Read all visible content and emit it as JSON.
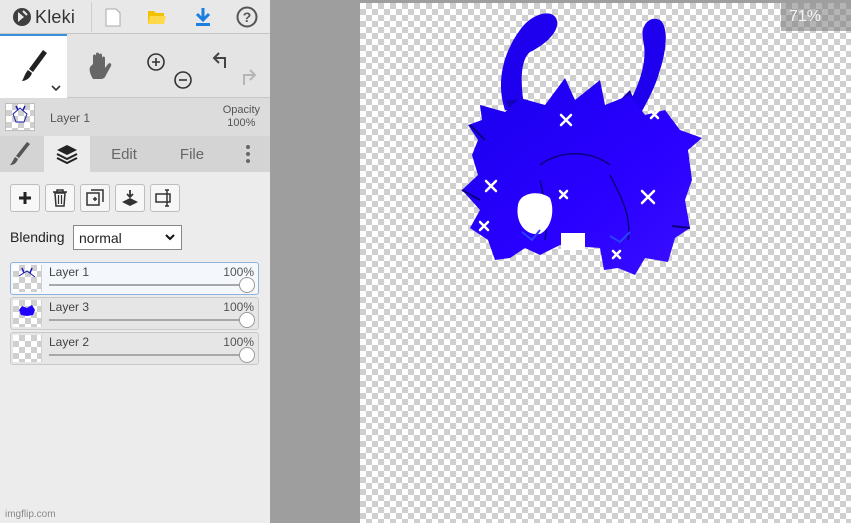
{
  "app": {
    "brand": "Kleki"
  },
  "active_layer": {
    "name": "Layer 1",
    "opacity_label": "Opacity",
    "opacity_value": "100%"
  },
  "tabs": {
    "edit": "Edit",
    "file": "File"
  },
  "blending": {
    "label": "Blending",
    "value": "normal"
  },
  "layers": [
    {
      "name": "Layer 1",
      "opacity": "100%",
      "active": true
    },
    {
      "name": "Layer 3",
      "opacity": "100%",
      "active": false
    },
    {
      "name": "Layer 2",
      "opacity": "100%",
      "active": false
    }
  ],
  "zoom": {
    "value": "71%"
  },
  "watermark": "imgflip.com",
  "colors": {
    "accent": "#3a8fd9",
    "download": "#1a7fe0",
    "folder": "#f2c200",
    "creature_fill": "#1f00ff"
  }
}
